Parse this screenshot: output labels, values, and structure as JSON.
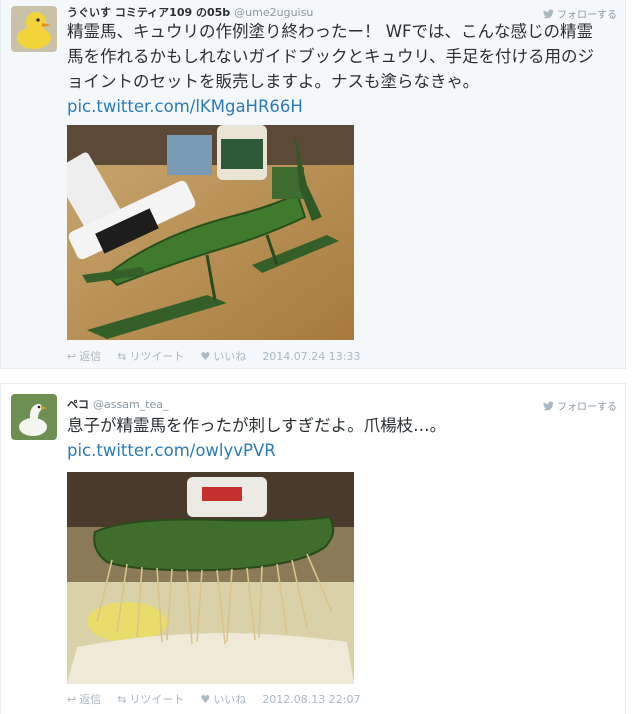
{
  "tweets": [
    {
      "name": "うぐいす コミティア109 の05b",
      "handle": "@ume2uguisu",
      "follow_label": "フォローする",
      "text": "精霊馬、キュウリの作例塗り終わったー！ WFでは、こんな感じの精霊馬を作れるかもしれないガイドブックとキュウリ、手足を付ける用のジョイントのセットを販売しますよ。ナスも塗らなきゃ。",
      "link": "pic.twitter.com/lKMgaHR66H",
      "reply_label": "返信",
      "retweet_label": "リツイート",
      "like_label": "いいね",
      "timestamp": "2014.07.24 13:33",
      "avatar_icon": "duck-avatar-icon",
      "photo_icon": "cucumber-plane-photo"
    },
    {
      "name": "ペコ",
      "handle": "@assam_tea_",
      "follow_label": "フォローする",
      "text": "息子が精霊馬を作ったが刺しすぎだよ。爪楊枝…。",
      "link": "pic.twitter.com/owlyvPVR",
      "reply_label": "返信",
      "retweet_label": "リツイート",
      "like_label": "いいね",
      "timestamp": "2012.08.13 22:07",
      "avatar_icon": "bird-avatar-icon",
      "photo_icon": "cucumber-toothpick-photo"
    }
  ],
  "colors": {
    "link": "#2b7bb9",
    "muted": "#aab8c2",
    "text": "#292f33",
    "cucumber": "#3f7a2e"
  }
}
